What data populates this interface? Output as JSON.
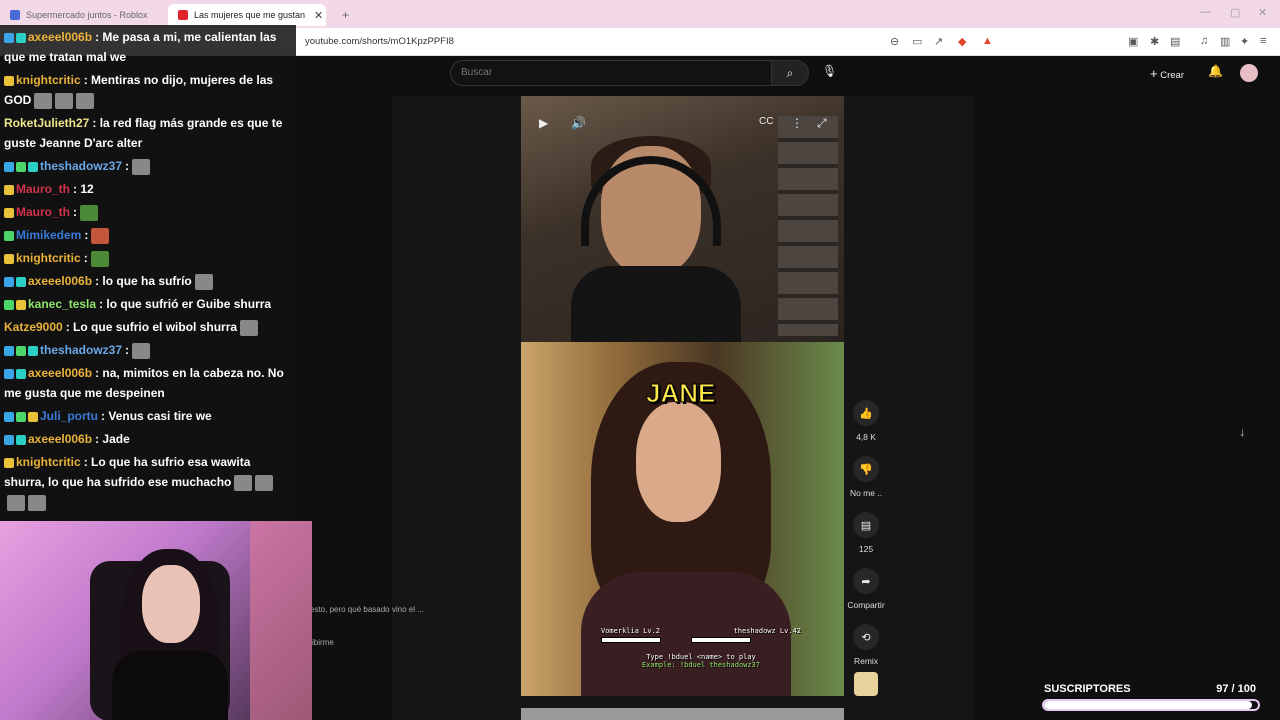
{
  "browser": {
    "tabs": [
      {
        "title": "Supermercado juntos - Roblox",
        "active": false
      },
      {
        "title": "Las mujeres que me gustan. - Yo",
        "active": true
      }
    ],
    "url": "youtube.com/shorts/mO1KpzPPFI8",
    "new_tab": "+"
  },
  "youtube": {
    "search_placeholder": "Buscar",
    "create_label": "Crear",
    "actions": {
      "like_count": "4,8 K",
      "dislike_label": "No me ..",
      "comments_count": "125",
      "share_label": "Compartir",
      "remix_label": "Remix"
    },
    "side_fragments": {
      "desc": "esto, pero qué basado vino el ...",
      "subscribe": "ibirme"
    }
  },
  "video": {
    "caption": "JANE",
    "game_hint_1": "Type !bduel <name> to play",
    "game_hint_2": "Example: !bduel theshadowz37",
    "player_left": "Vomerklia Lv.2",
    "player_right": "theshadowz Lv.42"
  },
  "chat": [
    {
      "user": "axeeel006b",
      "color": "#e9b23a",
      "text": ": Me pasa a mi, me calientan las que me tratan mal we"
    },
    {
      "user": "knightcritic",
      "color": "#e9b23a",
      "text": ": Mentiras no dijo, mujeres de las GOD"
    },
    {
      "user": "RoketJulieth27",
      "color": "#f0e68c",
      "text": ": la red flag más grande es que te guste Jeanne D'arc alter"
    },
    {
      "user": "theshadowz37",
      "color": "#6aa8e8",
      "text": ":"
    },
    {
      "user": "Mauro_th",
      "color": "#d0334a",
      "text": ": 12"
    },
    {
      "user": "Mauro_th",
      "color": "#d0334a",
      "text": ":"
    },
    {
      "user": "Mimikedem",
      "color": "#3a7ad8",
      "text": ":"
    },
    {
      "user": "knightcritic",
      "color": "#e9b23a",
      "text": ":"
    },
    {
      "user": "axeeel006b",
      "color": "#e9b23a",
      "text": ": lo que ha sufrío"
    },
    {
      "user": "kanec_tesla",
      "color": "#8fe46a",
      "text": ": lo que sufrió er Guibe shurra"
    },
    {
      "user": "Katze9000",
      "color": "#e9b23a",
      "text": ": Lo que sufrio el wibol shurra"
    },
    {
      "user": "theshadowz37",
      "color": "#6aa8e8",
      "text": ":"
    },
    {
      "user": "axeeel006b",
      "color": "#e9b23a",
      "text": ": na, mimitos en la cabeza no. No me gusta que me despeinen"
    },
    {
      "user": "Juli_portu",
      "color": "#3a7ad8",
      "text": ": Venus casi tire we"
    },
    {
      "user": "axeeel006b",
      "color": "#e9b23a",
      "text": ": Jade"
    },
    {
      "user": "knightcritic",
      "color": "#e9b23a",
      "text": ": Lo que ha sufrio esa wawita shurra, lo que ha sufrido ese muchacho"
    }
  ],
  "subs_goal": {
    "label": "SUSCRIPTORES",
    "count": "97 / 100",
    "progress": 0.97
  },
  "colors": {
    "yt_bg": "#0f0f0f",
    "tabbar": "#f3d9e8",
    "caption_yellow": "#ffe94a"
  }
}
